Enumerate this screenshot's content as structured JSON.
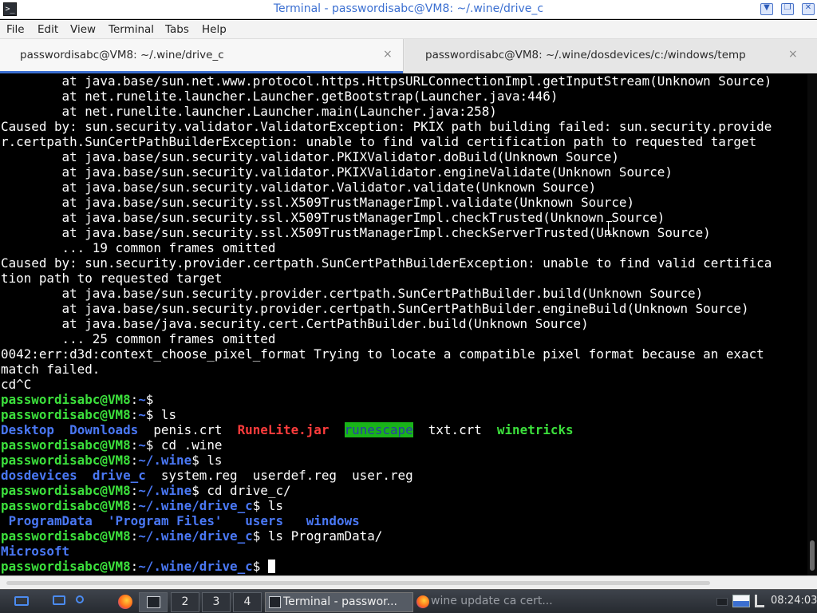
{
  "window": {
    "title": "Terminal - passwordisabc@VM8: ~/.wine/drive_c",
    "app_icon_glyph": ">_"
  },
  "menu": [
    "File",
    "Edit",
    "View",
    "Terminal",
    "Tabs",
    "Help"
  ],
  "tabs": [
    {
      "label": "passwordisabc@VM8: ~/.wine/drive_c",
      "close": "×",
      "active": true
    },
    {
      "label": "passwordisabc@VM8: ~/.wine/dosdevices/c:/windows/temp",
      "close": "×",
      "active": false
    }
  ],
  "terminal": {
    "lines": [
      [
        {
          "t": "        at java.base/sun.net.www.protocol.https.HttpsURLConnectionImpl.getInputStream(Unknown Source)"
        }
      ],
      [
        {
          "t": "        at net.runelite.launcher.Launcher.getBootstrap(Launcher.java:446)"
        }
      ],
      [
        {
          "t": "        at net.runelite.launcher.Launcher.main(Launcher.java:258)"
        }
      ],
      [
        {
          "t": "Caused by: sun.security.validator.ValidatorException: PKIX path building failed: sun.security.provide"
        }
      ],
      [
        {
          "t": "r.certpath.SunCertPathBuilderException: unable to find valid certification path to requested target"
        }
      ],
      [
        {
          "t": "        at java.base/sun.security.validator.PKIXValidator.doBuild(Unknown Source)"
        }
      ],
      [
        {
          "t": "        at java.base/sun.security.validator.PKIXValidator.engineValidate(Unknown Source)"
        }
      ],
      [
        {
          "t": "        at java.base/sun.security.validator.Validator.validate(Unknown Source)"
        }
      ],
      [
        {
          "t": "        at java.base/sun.security.ssl.X509TrustManagerImpl.validate(Unknown Source)"
        }
      ],
      [
        {
          "t": "        at java.base/sun.security.ssl.X509TrustManagerImpl.checkTrusted(Unknown Source)"
        }
      ],
      [
        {
          "t": "        at java.base/sun.security.ssl.X509TrustManagerImpl.checkServerTrusted(Unknown Source)"
        }
      ],
      [
        {
          "t": "        ... 19 common frames omitted"
        }
      ],
      [
        {
          "t": "Caused by: sun.security.provider.certpath.SunCertPathBuilderException: unable to find valid certifica"
        }
      ],
      [
        {
          "t": "tion path to requested target"
        }
      ],
      [
        {
          "t": "        at java.base/sun.security.provider.certpath.SunCertPathBuilder.build(Unknown Source)"
        }
      ],
      [
        {
          "t": "        at java.base/sun.security.provider.certpath.SunCertPathBuilder.engineBuild(Unknown Source)"
        }
      ],
      [
        {
          "t": "        at java.base/java.security.cert.CertPathBuilder.build(Unknown Source)"
        }
      ],
      [
        {
          "t": "        ... 25 common frames omitted"
        }
      ],
      [
        {
          "t": "0042:err:d3d:context_choose_pixel_format Trying to locate a compatible pixel format because an exact"
        }
      ],
      [
        {
          "t": "match failed."
        }
      ],
      [
        {
          "t": "cd^C"
        }
      ],
      [
        {
          "t": "passwordisabc@VM8",
          "c": "g"
        },
        {
          "t": ":"
        },
        {
          "t": "~",
          "c": "b"
        },
        {
          "t": "$"
        }
      ],
      [
        {
          "t": "passwordisabc@VM8",
          "c": "g"
        },
        {
          "t": ":"
        },
        {
          "t": "~",
          "c": "b"
        },
        {
          "t": "$ ls"
        }
      ],
      [
        {
          "t": "Desktop",
          "c": "b"
        },
        {
          "t": "  "
        },
        {
          "t": "Downloads",
          "c": "b"
        },
        {
          "t": "  penis.crt  "
        },
        {
          "t": "RuneLite.jar",
          "c": "r"
        },
        {
          "t": "  "
        },
        {
          "t": "runescape",
          "c": "hl"
        },
        {
          "t": "  txt.crt  "
        },
        {
          "t": "winetricks",
          "c": "g"
        }
      ],
      [
        {
          "t": "passwordisabc@VM8",
          "c": "g"
        },
        {
          "t": ":"
        },
        {
          "t": "~",
          "c": "b"
        },
        {
          "t": "$ cd .wine"
        }
      ],
      [
        {
          "t": "passwordisabc@VM8",
          "c": "g"
        },
        {
          "t": ":"
        },
        {
          "t": "~/.wine",
          "c": "b"
        },
        {
          "t": "$ ls"
        }
      ],
      [
        {
          "t": "dosdevices",
          "c": "b"
        },
        {
          "t": "  "
        },
        {
          "t": "drive_c",
          "c": "b"
        },
        {
          "t": "  system.reg  userdef.reg  user.reg"
        }
      ],
      [
        {
          "t": "passwordisabc@VM8",
          "c": "g"
        },
        {
          "t": ":"
        },
        {
          "t": "~/.wine",
          "c": "b"
        },
        {
          "t": "$ cd drive_c/"
        }
      ],
      [
        {
          "t": "passwordisabc@VM8",
          "c": "g"
        },
        {
          "t": ":"
        },
        {
          "t": "~/.wine/drive_c",
          "c": "b"
        },
        {
          "t": "$ ls"
        }
      ],
      [
        {
          "t": " "
        },
        {
          "t": "ProgramData",
          "c": "b"
        },
        {
          "t": "  "
        },
        {
          "t": "'Program Files'",
          "c": "b"
        },
        {
          "t": "   "
        },
        {
          "t": "users",
          "c": "b"
        },
        {
          "t": "   "
        },
        {
          "t": "windows",
          "c": "b"
        }
      ],
      [
        {
          "t": "passwordisabc@VM8",
          "c": "g"
        },
        {
          "t": ":"
        },
        {
          "t": "~/.wine/drive_c",
          "c": "b"
        },
        {
          "t": "$ ls ProgramData/"
        }
      ],
      [
        {
          "t": "Microsoft",
          "c": "b"
        }
      ],
      [
        {
          "t": "passwordisabc@VM8",
          "c": "g"
        },
        {
          "t": ":"
        },
        {
          "t": "~/.wine/drive_c",
          "c": "b"
        },
        {
          "t": "$ "
        },
        {
          "t": "",
          "c": "cursor"
        }
      ]
    ]
  },
  "taskbar": {
    "workspaces": [
      "2",
      "3",
      "4"
    ],
    "tasks": [
      {
        "label": "Terminal - passwor...",
        "active": true
      },
      {
        "label": "wine update ca cert...",
        "active": false
      }
    ],
    "clock": "08:24:03"
  },
  "colors": {
    "prompt_user": "#3ce03c",
    "prompt_path": "#4a78f5",
    "executable_red": "#ff3c3c",
    "highlight_bg": "#19b319",
    "title_text": "#3b6fd1"
  }
}
